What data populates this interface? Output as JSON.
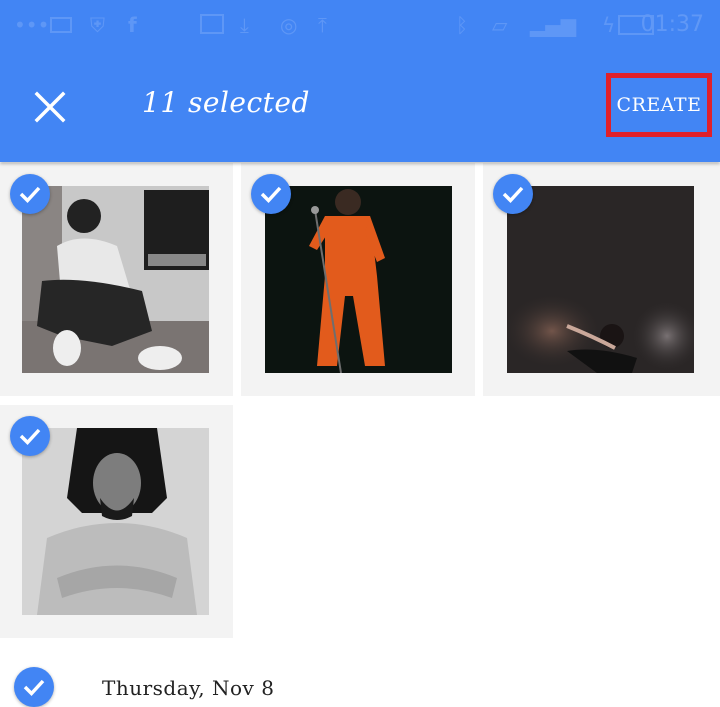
{
  "status_bar": {
    "time": "01:37",
    "icons": [
      "more-dots-icon",
      "message-icon",
      "shield-icon",
      "facebook-icon",
      "image-icon",
      "download-icon",
      "opera-icon",
      "upload-icon",
      "bluetooth-icon",
      "vibrate-icon",
      "signal-icon",
      "charging-icon",
      "battery-icon"
    ]
  },
  "app_bar": {
    "close_icon": "close-icon",
    "title": "11 selected",
    "create_label": "CREATE",
    "accent_color": "#4285f4",
    "highlight_color": "#e0202a"
  },
  "grid": {
    "tiles": [
      {
        "description": "Man in white shirt sitting on floor by fireplace (black and white)",
        "selected": true
      },
      {
        "description": "Performer in orange jumpsuit holding mic stand on dark stage",
        "selected": true
      },
      {
        "description": "Performer on smoky dark stage",
        "selected": true
      },
      {
        "description": "Man with dreadlocks in knit sweater (black and white)",
        "selected": true
      }
    ]
  },
  "date_section": {
    "label": "Thursday, Nov 8",
    "selected": true
  }
}
